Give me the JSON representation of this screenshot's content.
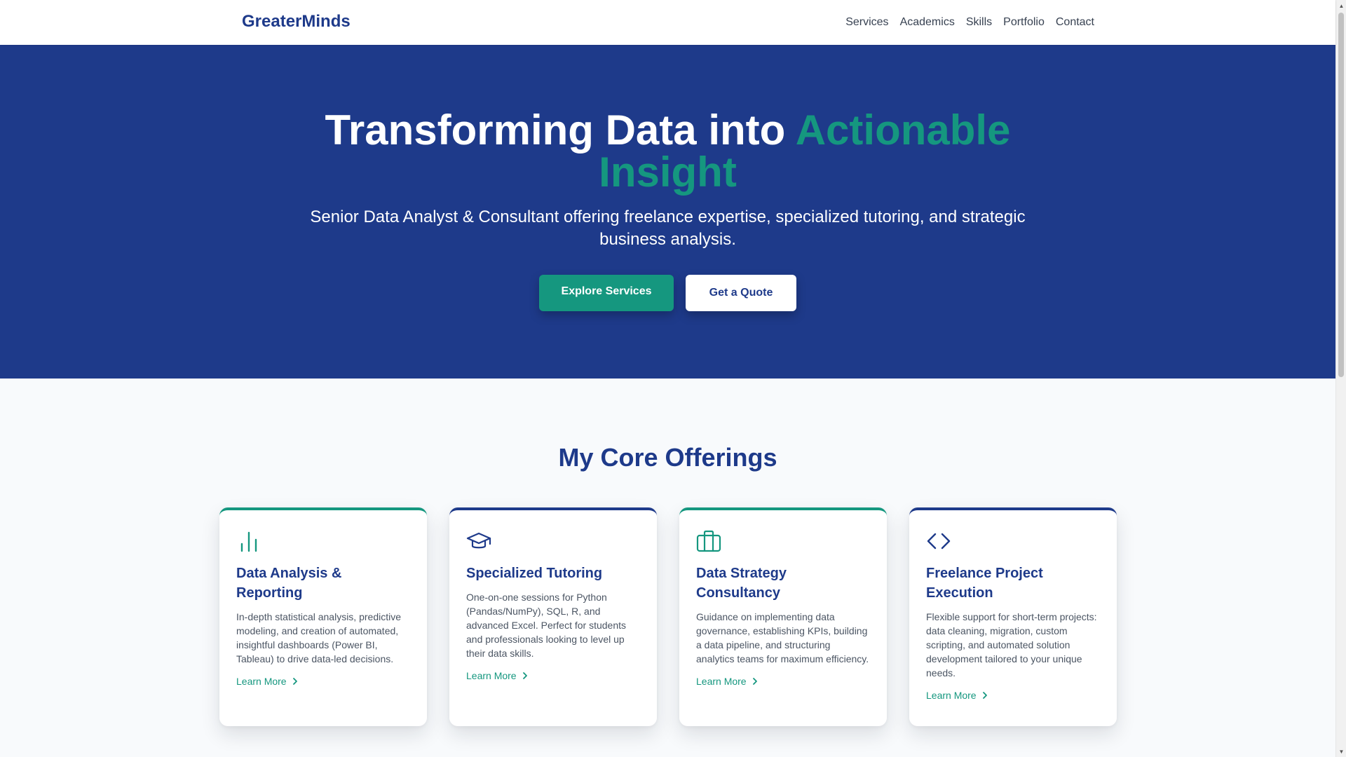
{
  "nav": {
    "brand": "GreaterMinds",
    "links": [
      "Services",
      "Academics",
      "Skills",
      "Portfolio",
      "Contact"
    ]
  },
  "hero": {
    "title_plain": "Transforming Data into ",
    "title_accent": "Actionable Insight",
    "subtitle": "Senior Data Analyst & Consultant offering freelance expertise, specialized tutoring, and strategic business analysis.",
    "primary_button": "Explore Services",
    "secondary_button": "Get a Quote"
  },
  "offerings": {
    "title": "My Core Offerings",
    "cards": [
      {
        "icon": "bar-chart-icon",
        "title": "Data Analysis & Reporting",
        "description": "In-depth statistical analysis, predictive modeling, and creation of automated, insightful dashboards (Power BI, Tableau) to drive data-led decisions.",
        "link": "Learn More"
      },
      {
        "icon": "graduation-cap-icon",
        "title": "Specialized Tutoring",
        "description": "One-on-one sessions for Python (Pandas/NumPy), SQL, R, and advanced Excel. Perfect for students and professionals looking to level up their data skills.",
        "link": "Learn More"
      },
      {
        "icon": "briefcase-icon",
        "title": "Data Strategy Consultancy",
        "description": "Guidance on implementing data governance, establishing KPIs, building a data pipeline, and structuring analytics teams for maximum efficiency.",
        "link": "Learn More"
      },
      {
        "icon": "code-icon",
        "title": "Freelance Project Execution",
        "description": "Flexible support for short-term projects: data cleaning, migration, custom scripting, and automated solution development tailored to your unique needs.",
        "link": "Learn More"
      }
    ]
  },
  "colors": {
    "navy": "#1e3a8a",
    "teal": "#15977f",
    "white": "#ffffff"
  }
}
